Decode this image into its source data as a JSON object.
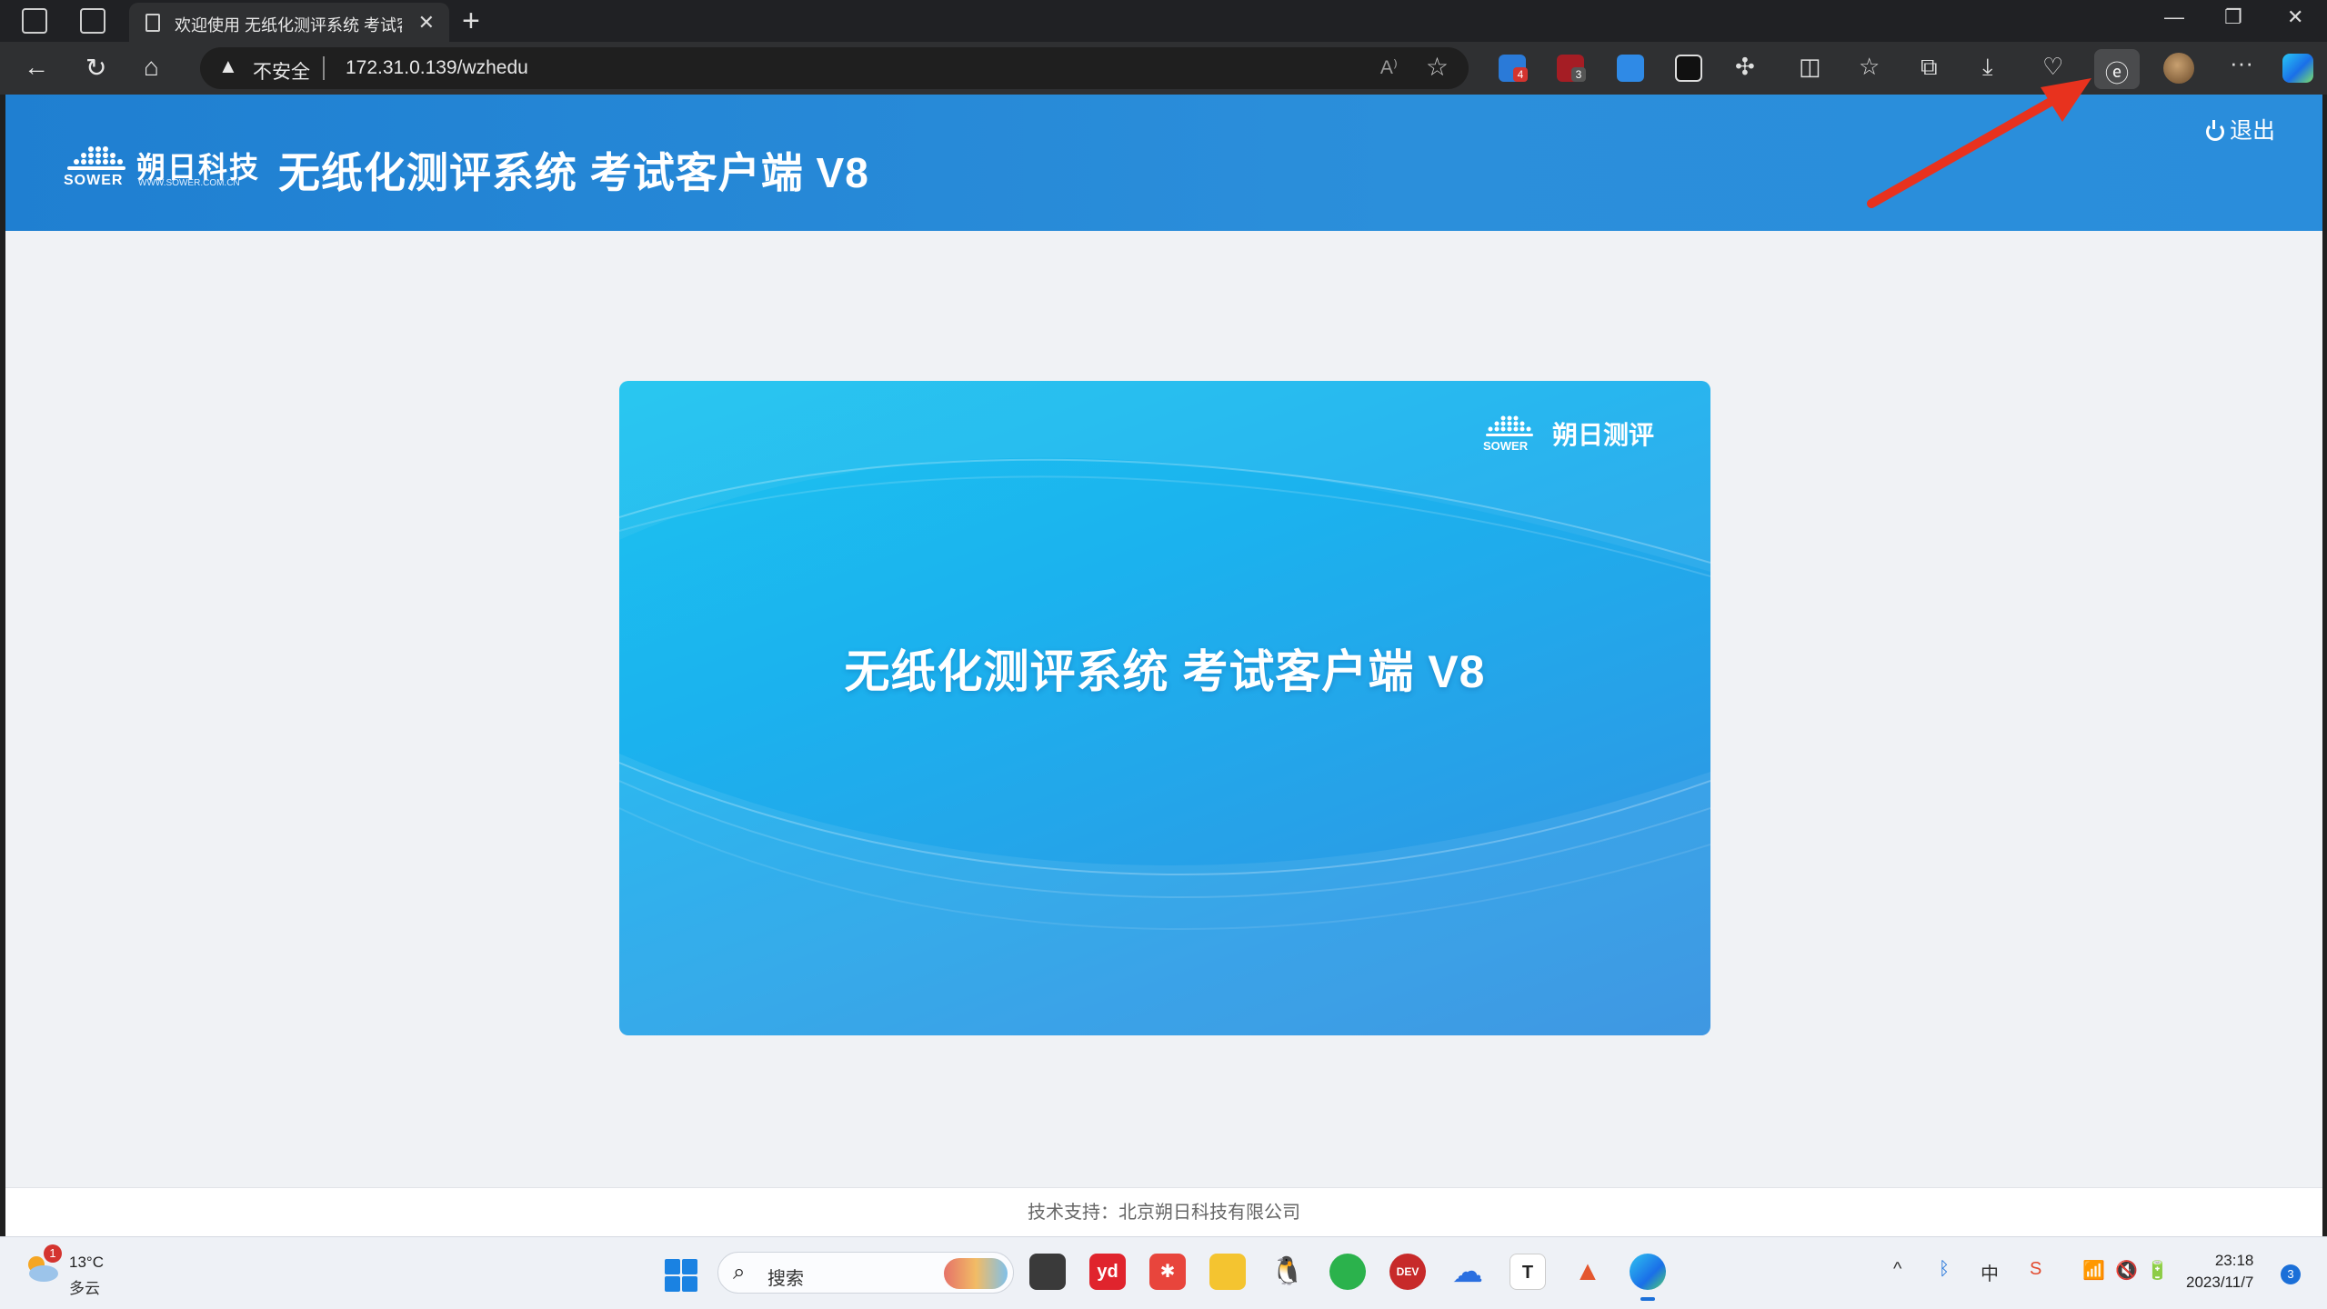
{
  "browser": {
    "tab_title": "欢迎使用 无纸化测评系统 考试客",
    "security_label": "不安全",
    "url": "172.31.0.139/wzhedu",
    "read_aloud_label": "A⁾",
    "extension_badges": [
      "4",
      "3"
    ]
  },
  "header": {
    "logo_text": "朔日科技",
    "logo_sub": "SOWER",
    "logo_url": "WWW.SOWER.COM.CN",
    "title": "无纸化测评系统 考试客户端 V8",
    "logout_label": "退出"
  },
  "card": {
    "brand_text": "朔日测评",
    "brand_sub": "SOWER",
    "title": "无纸化测评系统 考试客户端 V8"
  },
  "footer": {
    "text": "技术支持：北京朔日科技有限公司"
  },
  "taskbar": {
    "weather_temp": "13°C",
    "weather_desc": "多云",
    "weather_badge": "1",
    "search_placeholder": "搜索",
    "apps": [
      "file-explorer-dark",
      "youdao",
      "xmind",
      "folder",
      "qq",
      "wechat",
      "dev-cpp",
      "onedrive",
      "typora",
      "matlab",
      "edge"
    ],
    "ime_label": "中",
    "time": "23:18",
    "date": "2023/11/7",
    "notification_count": "3"
  },
  "colors": {
    "header_blue": "#2b8fdb",
    "card_cyan": "#1cc4f0",
    "arrow_red": "#e8321e"
  }
}
